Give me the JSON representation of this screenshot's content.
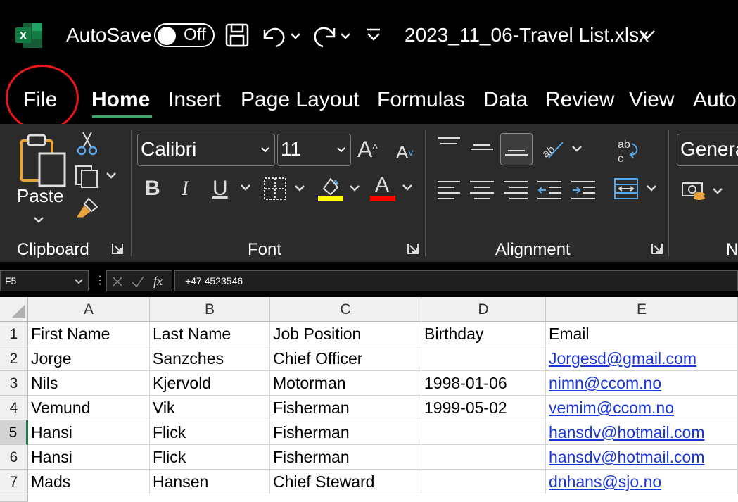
{
  "titlebar": {
    "autosave_label": "AutoSave",
    "autosave_state": "Off",
    "filename": "2023_11_06-Travel List.xlsx",
    "app_icon": "excel-icon",
    "accent": "#107c41"
  },
  "tabs": [
    "File",
    "Home",
    "Insert",
    "Page Layout",
    "Formulas",
    "Data",
    "Review",
    "View",
    "Auto"
  ],
  "active_tab": "Home",
  "ribbon": {
    "clipboard": {
      "paste_label": "Paste",
      "group_label": "Clipboard"
    },
    "font": {
      "font_name": "Calibri",
      "font_size": "11",
      "group_label": "Font",
      "bold": "B",
      "italic": "I",
      "underline": "U",
      "font_color_letter": "A",
      "highlight_color": "#ffff00",
      "font_color": "#ff0000",
      "grow": "A",
      "shrink": "A"
    },
    "alignment": {
      "group_label": "Alignment",
      "wrap_label": "ab c"
    },
    "number": {
      "format_value": "Genera",
      "group_label": "N"
    }
  },
  "formula_bar": {
    "name_box": "F5",
    "fx_label": "fx",
    "formula": "+47 4523546"
  },
  "sheet": {
    "columns": [
      "A",
      "B",
      "C",
      "D",
      "E"
    ],
    "rows": [
      {
        "num": "1",
        "cells": [
          "First Name",
          "Last Name",
          "Job Position",
          "Birthday",
          "Email"
        ]
      },
      {
        "num": "2",
        "cells": [
          "Jorge",
          "Sanzches",
          "Chief Officer",
          "",
          "Jorgesd@gmail.com"
        ]
      },
      {
        "num": "3",
        "cells": [
          "Nils",
          "Kjervold",
          "Motorman",
          "1998-01-06",
          "nimn@ccom.no"
        ]
      },
      {
        "num": "4",
        "cells": [
          "Vemund",
          "Vik",
          "Fisherman",
          "1999-05-02",
          "vemim@ccom.no"
        ]
      },
      {
        "num": "5",
        "cells": [
          "Hansi",
          "Flick",
          "Fisherman",
          "",
          "hansdv@hotmail.com"
        ]
      },
      {
        "num": "6",
        "cells": [
          "Hansi",
          "Flick",
          "Fisherman",
          "",
          "hansdv@hotmail.com"
        ]
      },
      {
        "num": "7",
        "cells": [
          "Mads",
          "Hansen",
          "Chief Steward",
          "",
          "dnhans@sjo.no"
        ]
      }
    ],
    "selected_row": "5"
  }
}
